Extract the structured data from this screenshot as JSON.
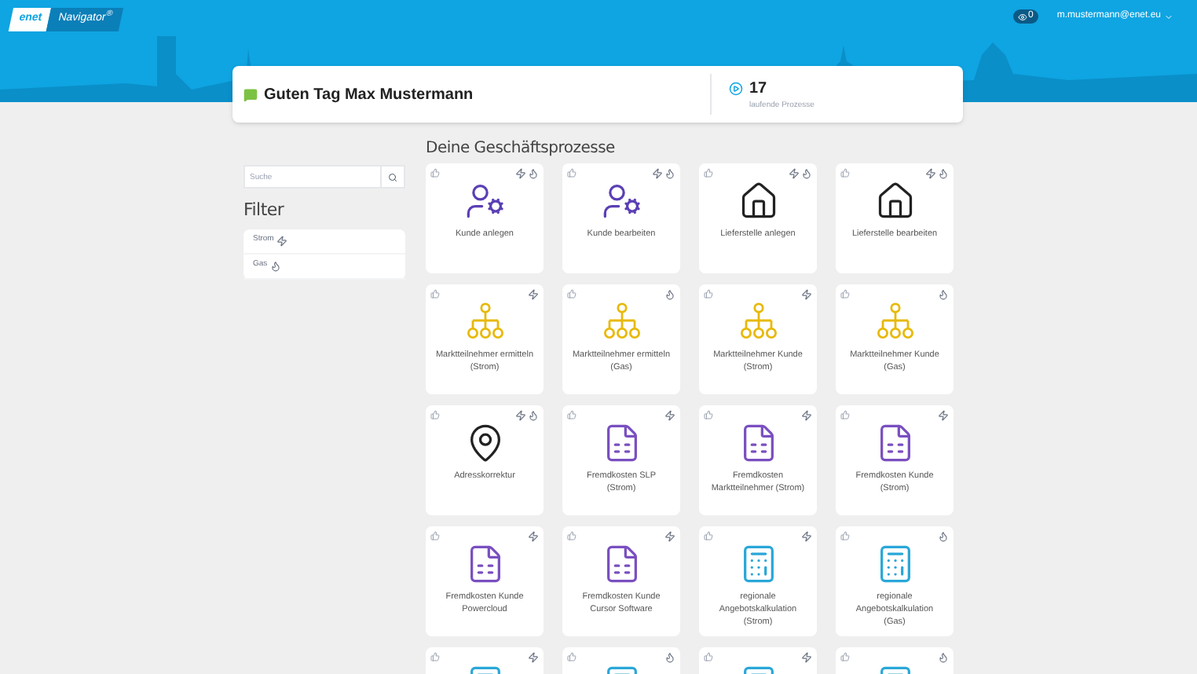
{
  "header": {
    "logo": "enet",
    "product": "Navigator$^{®}$",
    "notifications": "0",
    "user": "m.mustermann@enet.eu"
  },
  "greeting": {
    "message": "Guten Tag Max Mustermann",
    "count": "17",
    "count_label": "laufende Prozesse"
  },
  "sidebar": {
    "search": {
      "placeholder": "Suche"
    },
    "filter_title": "Filter",
    "filters": [
      {
        "label": "Strom",
        "kind": "strom"
      },
      {
        "label": "Gas",
        "kind": "gas"
      }
    ]
  },
  "section_title": "Deine Geschäftsprozesse",
  "cards": [
    {
      "kind": "person",
      "label": "Kunde anlegen",
      "strom": true,
      "gas": true
    },
    {
      "kind": "person",
      "label": "Kunde bearbeiten",
      "strom": true,
      "gas": true
    },
    {
      "kind": "house",
      "label": "Lieferstelle anlegen",
      "strom": true,
      "gas": true
    },
    {
      "kind": "house",
      "label": "Lieferstelle bearbeiten",
      "strom": true,
      "gas": true
    },
    {
      "kind": "org",
      "label": "Marktteilnehmer ermitteln (Strom)",
      "strom": true,
      "gas": false
    },
    {
      "kind": "org",
      "label": "Marktteilnehmer ermitteln (Gas)",
      "strom": false,
      "gas": true
    },
    {
      "kind": "org",
      "label": "Marktteilnehmer Kunde (Strom)",
      "strom": true,
      "gas": false
    },
    {
      "kind": "org",
      "label": "Marktteilnehmer Kunde (Gas)",
      "strom": false,
      "gas": true
    },
    {
      "kind": "pin",
      "label": "Adresskorrektur",
      "strom": true,
      "gas": true
    },
    {
      "kind": "document",
      "label": "Fremdkosten SLP (Strom)",
      "strom": true,
      "gas": false
    },
    {
      "kind": "document",
      "label": "Fremdkosten Marktteilnehmer (Strom)",
      "strom": true,
      "gas": false
    },
    {
      "kind": "document",
      "label": "Fremdkosten Kunde (Strom)",
      "strom": true,
      "gas": false
    },
    {
      "kind": "document",
      "label": "Fremdkosten Kunde Powercloud",
      "strom": true,
      "gas": false
    },
    {
      "kind": "document",
      "label": "Fremdkosten Kunde Cursor Software",
      "strom": true,
      "gas": false
    },
    {
      "kind": "calculator",
      "label": "regionale Angebotskalkulation (Strom)",
      "strom": true,
      "gas": false
    },
    {
      "kind": "calculator",
      "label": "regionale Angebotskalkulation (Gas)",
      "strom": false,
      "gas": true
    },
    {
      "kind": "calculator",
      "strom": true,
      "gas": false
    },
    {
      "kind": "calculator",
      "strom": false,
      "gas": true
    },
    {
      "kind": "calculator",
      "strom": true,
      "gas": false
    },
    {
      "kind": "calculator",
      "strom": false,
      "gas": true
    }
  ]
}
